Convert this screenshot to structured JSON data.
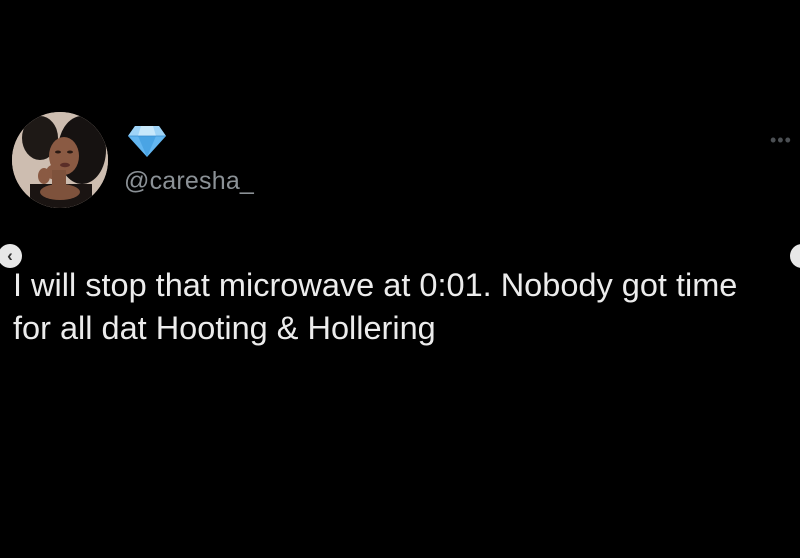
{
  "tweet": {
    "display_name_icon": "gem-icon",
    "handle": "@caresha_",
    "more_icon": "more-icon",
    "more_glyph": "•••",
    "text": "I will stop that microwave at 0:01. Nobody got time for all dat Hooting & Hollering"
  },
  "carousel": {
    "prev_glyph": "‹",
    "prev_icon": "chevron-left-icon",
    "next_icon": "chevron-right-icon"
  },
  "colors": {
    "background": "#000000",
    "text": "#ececec",
    "handle": "#8b9196",
    "gem": "#63b6f0"
  }
}
